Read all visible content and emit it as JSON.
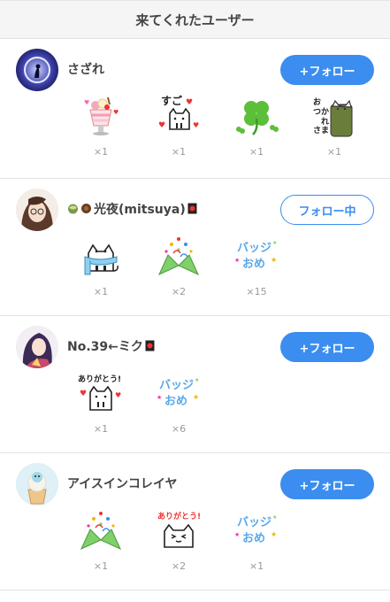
{
  "header": {
    "title": "来てくれたユーザー"
  },
  "users": [
    {
      "name": "さざれ",
      "follow_label": "+フォロー",
      "following": false,
      "gifts": [
        {
          "icon": "parfait-icon",
          "count": "×1"
        },
        {
          "icon": "cat-sugoi-icon",
          "count": "×1"
        },
        {
          "icon": "clover-icon",
          "count": "×1"
        },
        {
          "icon": "cat-otsukare-icon",
          "count": "×1"
        }
      ]
    },
    {
      "name": "光夜(mitsuya)",
      "follow_label": "フォロー中",
      "following": true,
      "gifts": [
        {
          "icon": "cat-scarf-icon",
          "count": "×1"
        },
        {
          "icon": "party-popper-icon",
          "count": "×2"
        },
        {
          "icon": "badge-omedeto-icon",
          "count": "×15"
        }
      ]
    },
    {
      "name": "No.39←ミク",
      "follow_label": "+フォロー",
      "following": false,
      "gifts": [
        {
          "icon": "cat-arigatou-icon",
          "count": "×1"
        },
        {
          "icon": "badge-omedeto-icon",
          "count": "×6"
        }
      ]
    },
    {
      "name": "アイスインコレイヤ",
      "follow_label": "+フォロー",
      "following": false,
      "gifts": [
        {
          "icon": "party-popper-icon",
          "count": "×1"
        },
        {
          "icon": "cat-arigatou-banner-icon",
          "count": "×2"
        },
        {
          "icon": "badge-omedeto-icon",
          "count": "×1"
        }
      ]
    }
  ],
  "colors": {
    "accent": "#3b8def",
    "divider": "#e2e2e2",
    "count_text": "#999999"
  }
}
